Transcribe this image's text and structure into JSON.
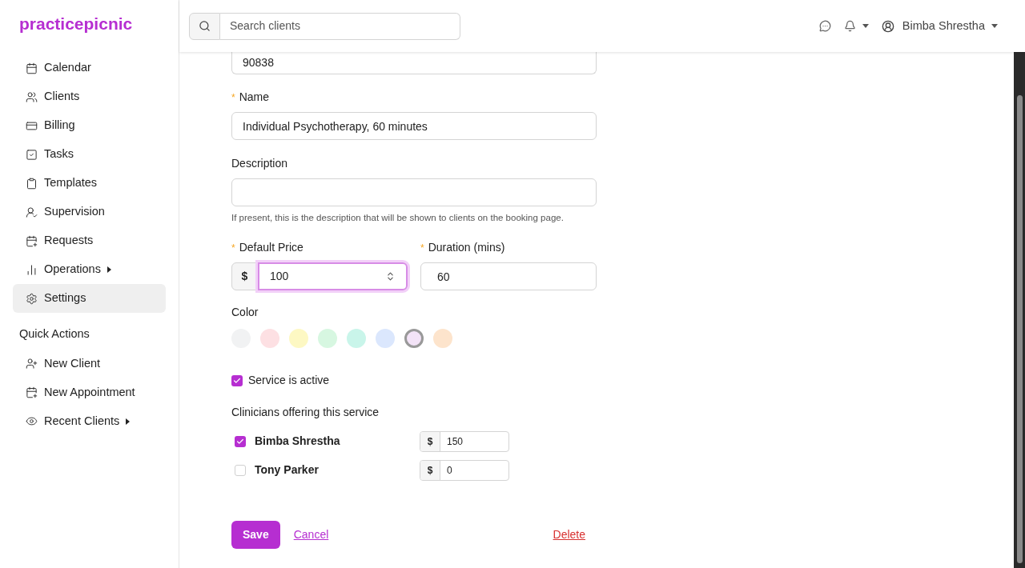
{
  "brand": "practicepicnic",
  "sidebar": {
    "items": [
      {
        "label": "Calendar",
        "selected": false
      },
      {
        "label": "Clients",
        "selected": false
      },
      {
        "label": "Billing",
        "selected": false
      },
      {
        "label": "Tasks",
        "selected": false
      },
      {
        "label": "Templates",
        "selected": false
      },
      {
        "label": "Supervision",
        "selected": false
      },
      {
        "label": "Requests",
        "selected": false
      },
      {
        "label": "Operations",
        "selected": false,
        "submenu": true
      },
      {
        "label": "Settings",
        "selected": true
      }
    ],
    "quick_actions_title": "Quick Actions",
    "quick_actions": [
      {
        "label": "New Client"
      },
      {
        "label": "New Appointment"
      },
      {
        "label": "Recent Clients",
        "submenu": true
      }
    ]
  },
  "header": {
    "search": {
      "placeholder": "Search clients"
    },
    "user": "Bimba Shrestha"
  },
  "form": {
    "code": {
      "value": "90838"
    },
    "name": {
      "label": "Name",
      "marker": "*",
      "value": "Individual Psychotherapy, 60 minutes"
    },
    "description": {
      "label": "Description",
      "help": "If present, this is the description that will be shown to clients on the booking page."
    },
    "price": {
      "label": "Default Price",
      "marker": "*",
      "prefix": "$",
      "value": "100",
      "focused": true
    },
    "duration": {
      "label": "Duration (mins)",
      "marker": "*",
      "value": "60"
    },
    "color": {
      "label": "Color",
      "options": [
        {
          "color": "#f1f2f3",
          "selected": false
        },
        {
          "color": "#fde0e3",
          "selected": false
        },
        {
          "color": "#fdf8c3",
          "selected": false
        },
        {
          "color": "#d7f7e1",
          "selected": false
        },
        {
          "color": "#c9f5ea",
          "selected": false
        },
        {
          "color": "#dbe7fd",
          "selected": false
        },
        {
          "color": "#f3e3f7",
          "selected": true
        },
        {
          "color": "#fde4cc",
          "selected": false
        }
      ]
    },
    "active": {
      "label": "Service is active",
      "checked": true
    },
    "clinicians_title": "Clinicians offering this service",
    "clinicians": [
      {
        "name": "Bimba Shrestha",
        "checked": true,
        "prefix": "$",
        "price": "150"
      },
      {
        "name": "Tony Parker",
        "checked": false,
        "prefix": "$",
        "price": "0"
      }
    ],
    "buttons": {
      "save": "Save",
      "cancel": "Cancel",
      "delete": "Delete"
    }
  }
}
